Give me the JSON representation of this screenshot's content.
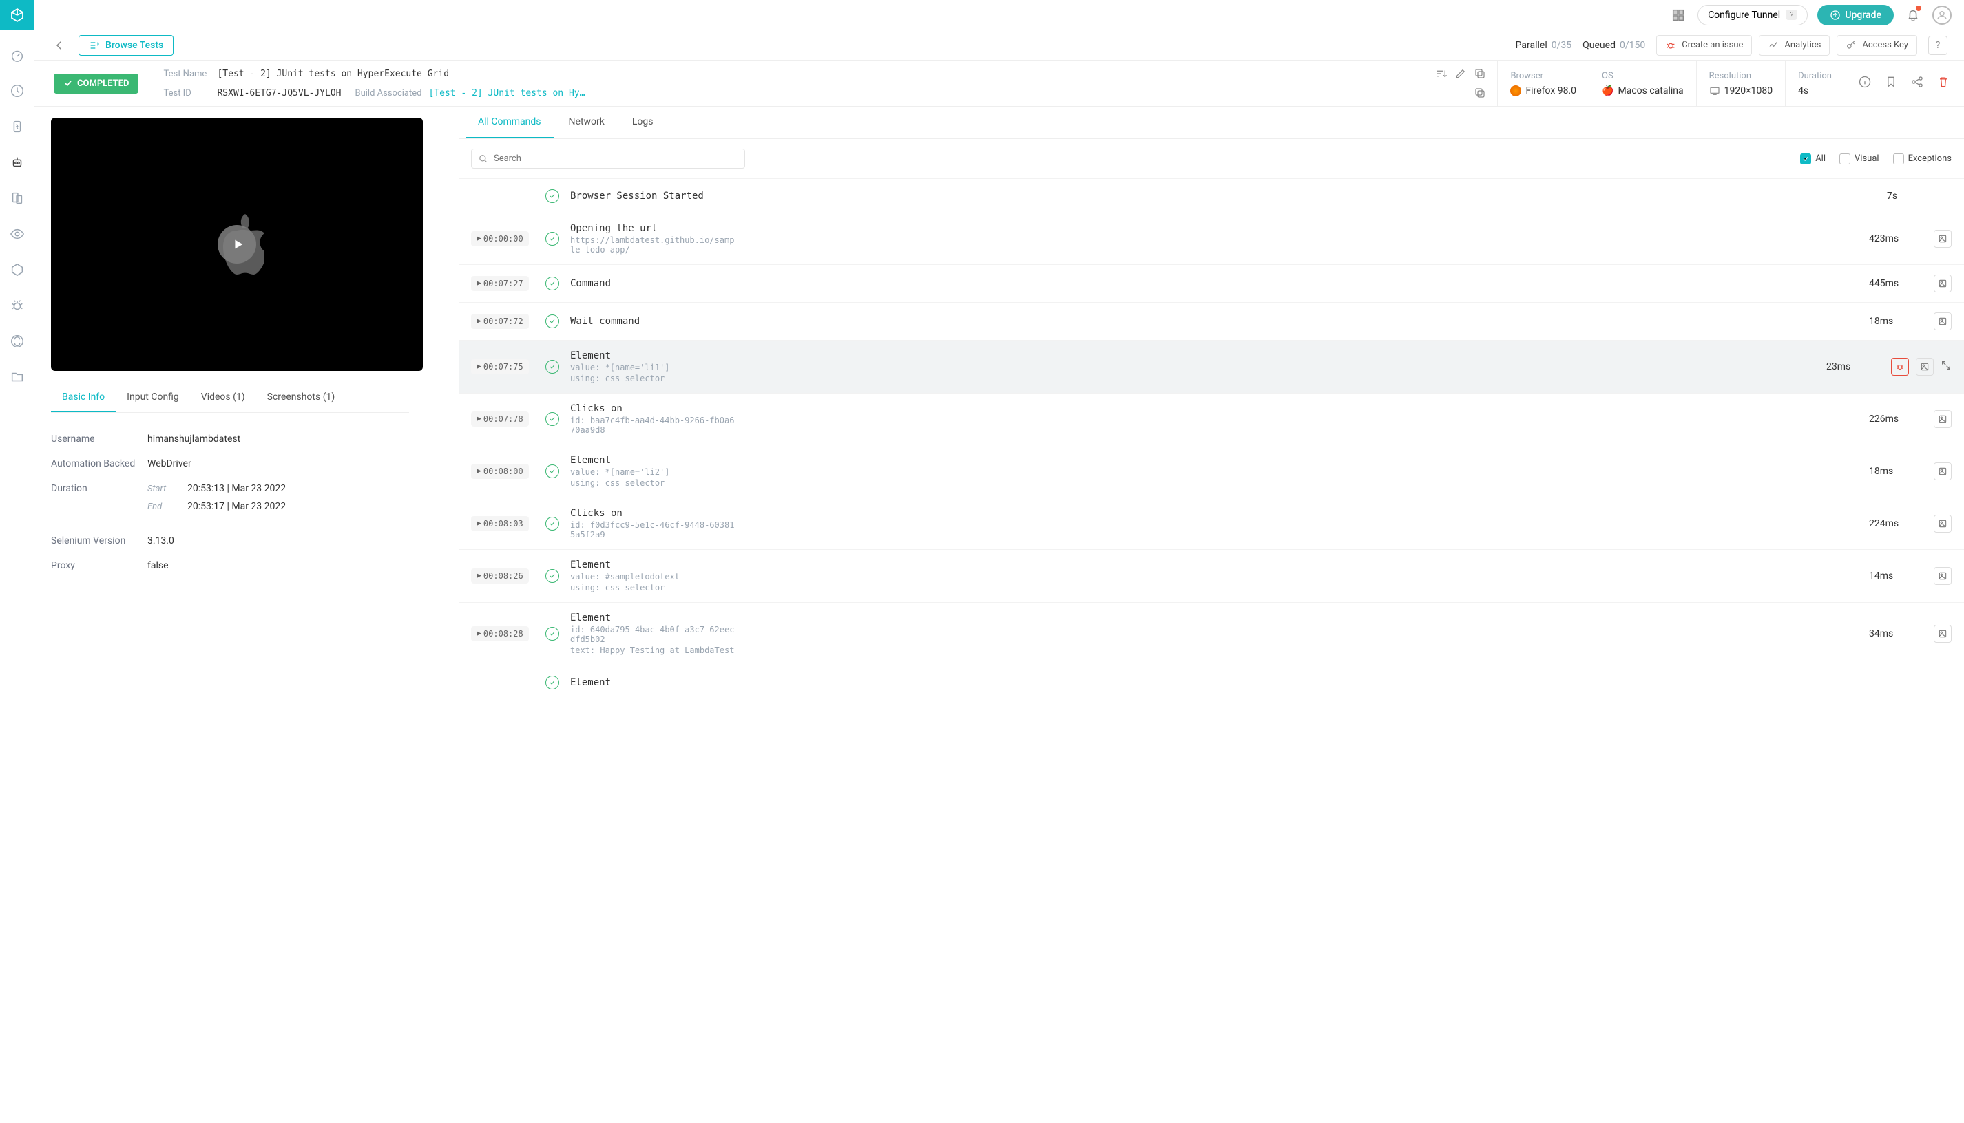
{
  "topbar": {
    "configure_label": "Configure Tunnel",
    "upgrade_label": "Upgrade"
  },
  "subbar": {
    "browse_label": "Browse Tests",
    "parallel_label": "Parallel",
    "parallel_frac": "0/35",
    "queued_label": "Queued",
    "queued_frac": "0/150",
    "create_issue": "Create an issue",
    "analytics": "Analytics",
    "access_key": "Access Key"
  },
  "status_badge": "COMPLETED",
  "meta": {
    "test_name_label": "Test Name",
    "test_name": "[Test - 2] JUnit tests on HyperExecute Grid",
    "test_id_label": "Test ID",
    "test_id": "RSXWI-6ETG7-JQ5VL-JYLOH",
    "build_assoc_label": "Build Associated",
    "build_assoc": "[Test - 2] JUnit tests on Hy…",
    "browser_label": "Browser",
    "browser": "Firefox 98.0",
    "os_label": "OS",
    "os": "Macos catalina",
    "resolution_label": "Resolution",
    "resolution": "1920×1080",
    "duration_label": "Duration",
    "duration": "4s"
  },
  "info_tabs": [
    "Basic Info",
    "Input Config",
    "Videos (1)",
    "Screenshots (1)"
  ],
  "basic_info": {
    "username_k": "Username",
    "username_v": "himanshujlambdatest",
    "auto_k": "Automation Backed",
    "auto_v": "WebDriver",
    "duration_k": "Duration",
    "start_k": "Start",
    "start_v": "20:53:13 | Mar 23 2022",
    "end_k": "End",
    "end_v": "20:53:17 | Mar 23 2022",
    "selenium_k": "Selenium Version",
    "selenium_v": "3.13.0",
    "proxy_k": "Proxy",
    "proxy_v": "false"
  },
  "cmd_tabs": [
    "All Commands",
    "Network",
    "Logs"
  ],
  "search_placeholder": "Search",
  "filters": {
    "all": "All",
    "visual": "Visual",
    "exceptions": "Exceptions"
  },
  "commands": [
    {
      "ts": "",
      "title": "Browser Session Started",
      "sub": "",
      "dur": "7s",
      "selected": false,
      "has_img": false
    },
    {
      "ts": "00:00:00",
      "title": "Opening the url",
      "sub": "https://lambdatest.github.io/sample-todo-app/",
      "dur": "423ms",
      "selected": false,
      "has_img": true
    },
    {
      "ts": "00:07:27",
      "title": "Command",
      "sub": "",
      "dur": "445ms",
      "selected": false,
      "has_img": true
    },
    {
      "ts": "00:07:72",
      "title": "Wait command",
      "sub": "",
      "dur": "18ms",
      "selected": false,
      "has_img": true
    },
    {
      "ts": "00:07:75",
      "title": "Element",
      "sub": "value: *[name='li1']\nusing: css selector",
      "dur": "23ms",
      "selected": true,
      "has_img": true,
      "bug": true,
      "expand": true
    },
    {
      "ts": "00:07:78",
      "title": "Clicks on",
      "sub": "id: baa7c4fb-aa4d-44bb-9266-fb0a670aa9d8",
      "dur": "226ms",
      "selected": false,
      "has_img": true
    },
    {
      "ts": "00:08:00",
      "title": "Element",
      "sub": "value: *[name='li2']\nusing: css selector",
      "dur": "18ms",
      "selected": false,
      "has_img": true
    },
    {
      "ts": "00:08:03",
      "title": "Clicks on",
      "sub": "id: f0d3fcc9-5e1c-46cf-9448-603815a5f2a9",
      "dur": "224ms",
      "selected": false,
      "has_img": true
    },
    {
      "ts": "00:08:26",
      "title": "Element",
      "sub": "value: #sampletodotext\nusing: css selector",
      "dur": "14ms",
      "selected": false,
      "has_img": true
    },
    {
      "ts": "00:08:28",
      "title": "Element",
      "sub": "id: 640da795-4bac-4b0f-a3c7-62eecdfd5b02\ntext: Happy Testing at LambdaTest",
      "dur": "34ms",
      "selected": false,
      "has_img": true
    },
    {
      "ts": "",
      "title": "Element",
      "sub": "",
      "dur": "",
      "selected": false,
      "has_img": false
    }
  ]
}
